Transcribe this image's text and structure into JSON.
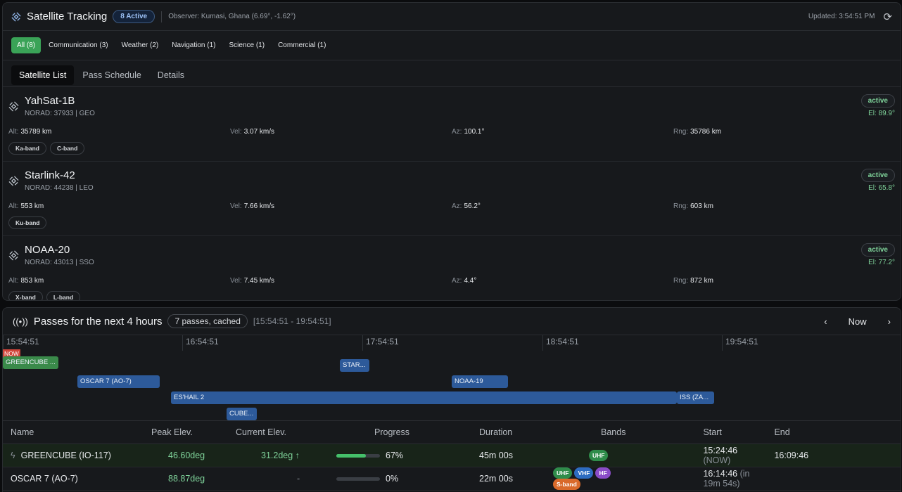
{
  "header": {
    "title": "Satellite Tracking",
    "active_badge": "8 Active",
    "observer": "Observer: Kumasi, Ghana (6.69°, -1.62°)",
    "updated": "Updated: 3:54:51 PM"
  },
  "filters": [
    "All (8)",
    "Communication (3)",
    "Weather (2)",
    "Navigation (1)",
    "Science (1)",
    "Commercial (1)"
  ],
  "tabs": [
    "Satellite List",
    "Pass Schedule",
    "Details"
  ],
  "satellites": [
    {
      "name": "YahSat-1B",
      "meta": "NORAD: 37933 | GEO",
      "status": "active",
      "elevation": "El: 89.9°",
      "alt_label": "Alt:",
      "alt": "35789 km",
      "vel_label": "Vel:",
      "vel": "3.07 km/s",
      "az_label": "Az:",
      "az": "100.1°",
      "rng_label": "Rng:",
      "rng": "35786 km",
      "bands": [
        "Ka-band",
        "C-band"
      ]
    },
    {
      "name": "Starlink-42",
      "meta": "NORAD: 44238 | LEO",
      "status": "active",
      "elevation": "El: 65.8°",
      "alt_label": "Alt:",
      "alt": "553 km",
      "vel_label": "Vel:",
      "vel": "7.66 km/s",
      "az_label": "Az:",
      "az": "56.2°",
      "rng_label": "Rng:",
      "rng": "603 km",
      "bands": [
        "Ku-band"
      ]
    },
    {
      "name": "NOAA-20",
      "meta": "NORAD: 43013 | SSO",
      "status": "active",
      "elevation": "El: 77.2°",
      "alt_label": "Alt:",
      "alt": "853 km",
      "vel_label": "Vel:",
      "vel": "7.45 km/s",
      "az_label": "Az:",
      "az": "4.4°",
      "rng_label": "Rng:",
      "rng": "872 km",
      "bands": [
        "X-band",
        "L-band"
      ]
    }
  ],
  "passes": {
    "title": "Passes for the next 4 hours",
    "count": "7 passes, cached",
    "range": "[15:54:51 - 19:54:51]",
    "now_button": "Now",
    "now_tag": "NOW",
    "ticks": [
      "15:54:51",
      "16:54:51",
      "17:54:51",
      "18:54:51",
      "19:54:51"
    ],
    "bars": [
      {
        "label": "GREENCUBE ...",
        "color": "#3a8a4a"
      },
      {
        "label": "OSCAR 7 (AO-7)",
        "color": "#2d5a9a"
      },
      {
        "label": "STAR...",
        "color": "#2d5a9a"
      },
      {
        "label": "NOAA-19",
        "color": "#2d5a9a"
      },
      {
        "label": "ES'HAIL 2",
        "color": "#2d5a9a"
      },
      {
        "label": "ISS (ZA...",
        "color": "#2d5a9a"
      },
      {
        "label": "CUBE...",
        "color": "#2d5a9a"
      }
    ],
    "columns": [
      "Name",
      "Peak Elev.",
      "Current Elev.",
      "Progress",
      "Duration",
      "Bands",
      "Start",
      "End"
    ],
    "rows": [
      {
        "name": "GREENCUBE (IO-117)",
        "peak": "46.60deg",
        "current": "31.2deg ↑",
        "progress": 67,
        "progress_text": "67%",
        "duration": "45m 00s",
        "bands": [
          {
            "label": "UHF",
            "color": "#2f8c4a"
          }
        ],
        "start": "15:24:46",
        "start_note": "(NOW)",
        "end": "16:09:46"
      },
      {
        "name": "OSCAR 7 (AO-7)",
        "peak": "88.87deg",
        "current": "-",
        "progress": 0,
        "progress_text": "0%",
        "duration": "22m 00s",
        "bands": [
          {
            "label": "UHF",
            "color": "#2f8c4a"
          },
          {
            "label": "VHF",
            "color": "#2d6cc0"
          },
          {
            "label": "HF",
            "color": "#8a4cc7"
          },
          {
            "label": "S-band",
            "color": "#d96a2b"
          }
        ],
        "start": "16:14:46",
        "start_note": "(in 19m 54s)",
        "end": ""
      }
    ]
  }
}
